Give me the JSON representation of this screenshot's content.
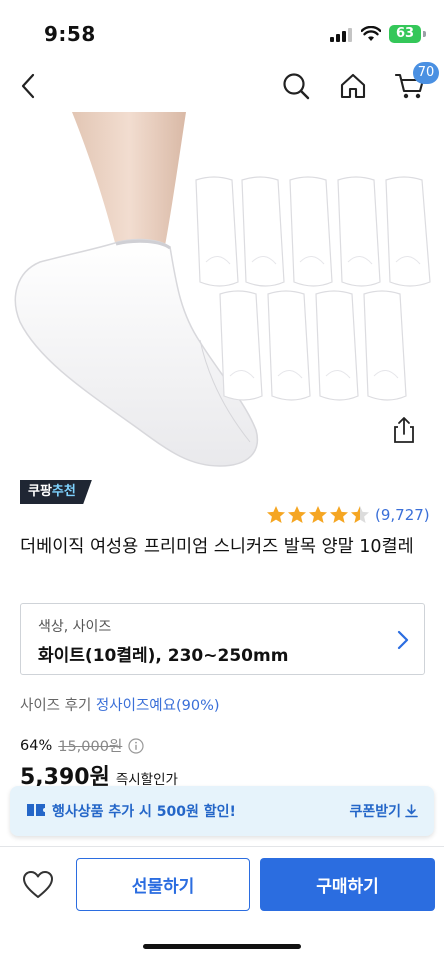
{
  "status_bar": {
    "time": "9:58",
    "battery": "63"
  },
  "nav": {
    "cart_count": "70"
  },
  "recommend_badge": {
    "prefix": "쿠팡",
    "highlight": "추천"
  },
  "rating": {
    "stars": 4.5,
    "review_count": "(9,727)"
  },
  "product": {
    "title": "더베이직 여성용 프리미엄 스니커즈 발목 양말 10켤레"
  },
  "option": {
    "label": "색상, 사이즈",
    "value": "화이트(10켤레), 230~250mm"
  },
  "size_review": {
    "prefix": "사이즈 후기",
    "value": "정사이즈예요(90%)"
  },
  "price": {
    "discount": "64%",
    "original": "15,000원",
    "final": "5,390원",
    "final_label": "즉시할인가"
  },
  "coupon": {
    "text": "행사상품 추가 시 500원 할인!",
    "action": "쿠폰받기"
  },
  "actions": {
    "gift": "선물하기",
    "buy": "구매하기"
  },
  "colors": {
    "accent": "#2b6de0",
    "link": "#3a6fd8",
    "star": "#f5a623",
    "coupon_bg": "#e6f3fb",
    "badge_bg": "#1f2633",
    "battery": "#34c759"
  },
  "icons": [
    "back-icon",
    "search-icon",
    "home-icon",
    "cart-icon",
    "share-icon",
    "info-icon",
    "coupon-icon",
    "download-icon",
    "heart-icon",
    "chevron-right-icon"
  ]
}
